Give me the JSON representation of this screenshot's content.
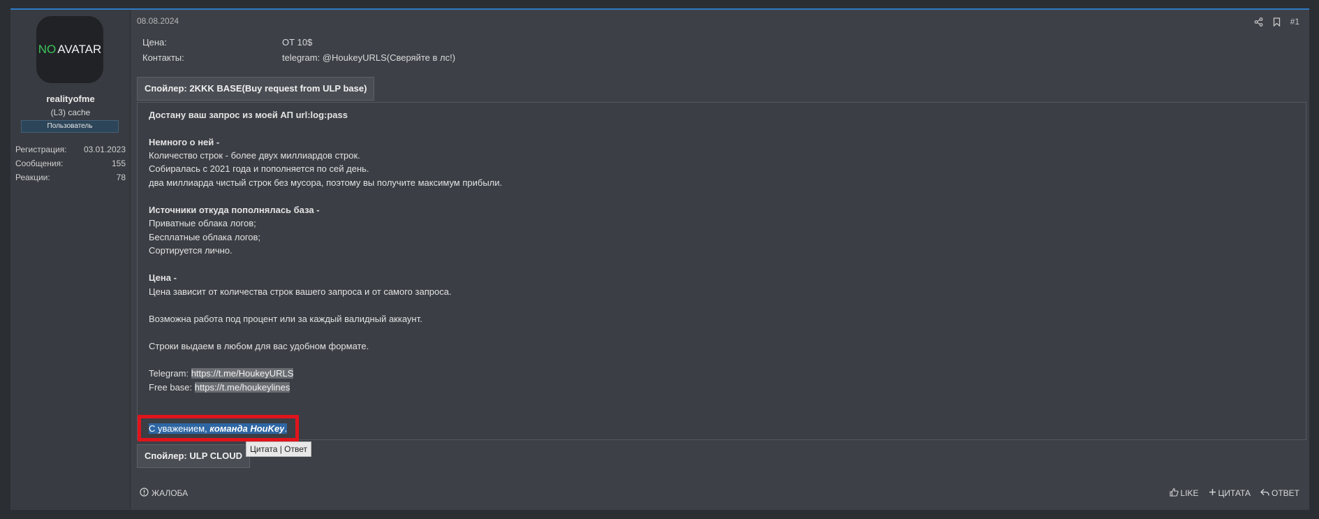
{
  "user": {
    "avatar_no": "NO",
    "avatar_rest": "AVATAR",
    "name": "realityofme",
    "title": "(L3) cache",
    "role": "Пользователь",
    "stats": [
      {
        "label": "Регистрация:",
        "value": "03.01.2023"
      },
      {
        "label": "Сообщения:",
        "value": "155"
      },
      {
        "label": "Реакции:",
        "value": "78"
      }
    ]
  },
  "post": {
    "date": "08.08.2024",
    "number": "#1",
    "price_label": "Цена:",
    "price_value": "ОТ 10$",
    "contacts_label": "Контакты:",
    "contacts_value": "telegram: @HoukeyURLS(Сверяйте в лс!)"
  },
  "spoiler1": {
    "title": "Спойлер: 2KKK BASE(Buy request from ULP base)",
    "lines": {
      "l1": "Достану ваш запрос из моей АП url:log:pass",
      "l2": "Немного о ней -",
      "l3": "Количество строк - более двух миллиардов строк.",
      "l4": "Собиралась с 2021 года и пополняется по сей день.",
      "l5": "два миллиарда чистый строк без мусора, поэтому вы получите максимум прибыли.",
      "l6": "Источники откуда пополнялась база -",
      "l7": "Приватные облака логов;",
      "l8": "Бесплатные облака логов;",
      "l9": "Сортируется лично.",
      "l10": "Цена -",
      "l11": "Цена зависит от количества строк вашего запроса и от самого запроса.",
      "l12": "Возможна работа под процент или за каждый валидный аккаунт.",
      "l13": "Строки выдаем в любом для вас удобном формате.",
      "tg_label": "Telegram: ",
      "tg_link": "https://t.me/HoukeyURLS",
      "fb_label": "Free base: ",
      "fb_link": "https://t.me/houkeylines",
      "sign_plain": "С уважением, ",
      "sign_em": "команда HouKey",
      "sign_end": "."
    }
  },
  "spoiler2": {
    "title": "Спойлер: ULP CLOUD"
  },
  "tooltip": "Цитата | Ответ",
  "actions": {
    "report": "ЖАЛОБА",
    "like": "LIKE",
    "quote": "ЦИТАТА",
    "reply": "ОТВЕТ"
  },
  "colors": {
    "accent": "#2f7bc5",
    "highlight": "#e0141c",
    "selection": "#2e66a3"
  }
}
